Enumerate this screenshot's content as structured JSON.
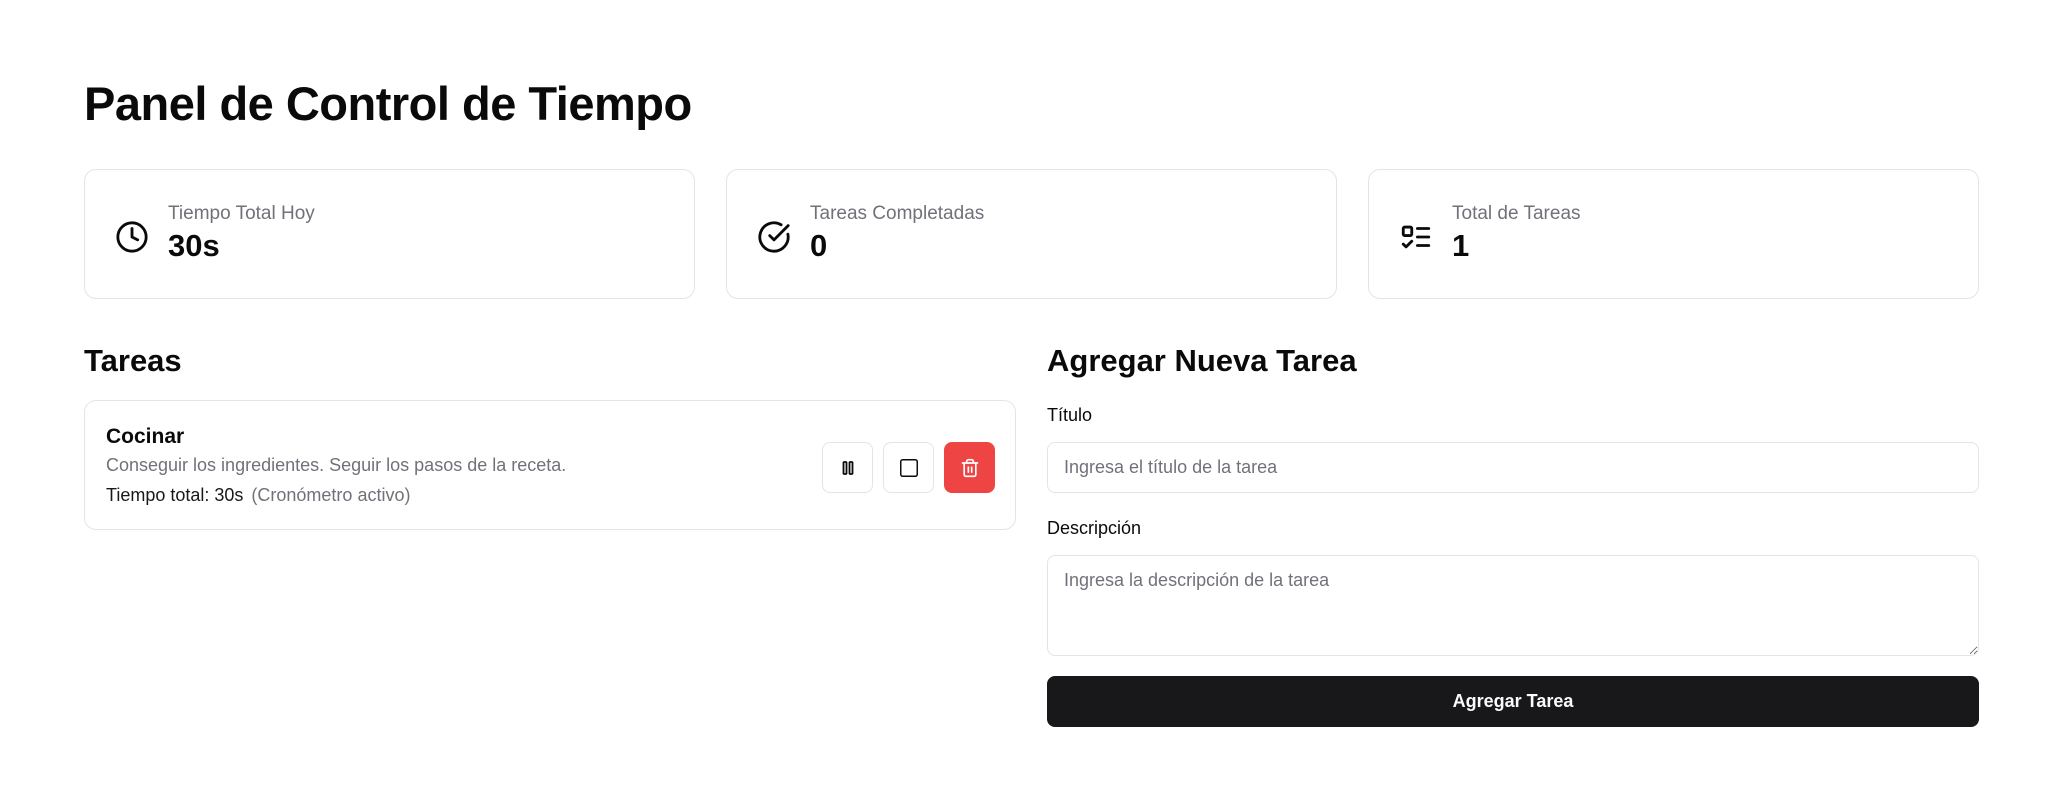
{
  "page": {
    "title": "Panel de Control de Tiempo"
  },
  "stats": [
    {
      "icon": "clock-icon",
      "label": "Tiempo Total Hoy",
      "value": "30s"
    },
    {
      "icon": "check-circle-icon",
      "label": "Tareas Completadas",
      "value": "0"
    },
    {
      "icon": "list-checks-icon",
      "label": "Total de Tareas",
      "value": "1"
    }
  ],
  "tasks": {
    "heading": "Tareas",
    "items": [
      {
        "title": "Cocinar",
        "description": "Conseguir los ingredientes. Seguir los pasos de la receta.",
        "time": "Tiempo total: 30s",
        "status": "(Cronómetro activo)",
        "actions": [
          "pause-icon",
          "checkbox",
          "trash-icon"
        ]
      }
    ]
  },
  "form": {
    "heading": "Agregar Nueva Tarea",
    "title_label": "Título",
    "title_placeholder": "Ingresa el título de la tarea",
    "title_value": "",
    "description_label": "Descripción",
    "description_placeholder": "Ingresa la descripción de la tarea",
    "description_value": "",
    "submit_label": "Agregar Tarea"
  },
  "colors": {
    "danger": "#ef4444",
    "primary": "#18181b",
    "border": "#e4e4e7",
    "muted": "#71717a"
  }
}
